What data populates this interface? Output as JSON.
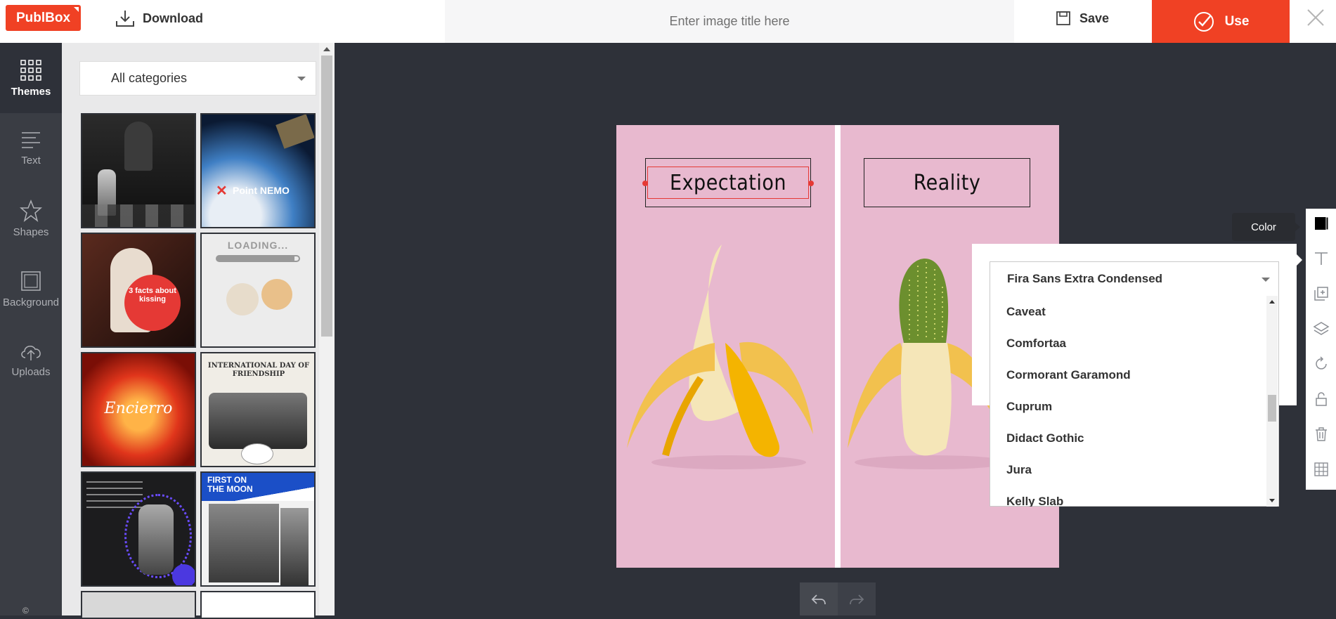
{
  "app": {
    "logo": "PublBox"
  },
  "header": {
    "download_label": "Download",
    "title_placeholder": "Enter image title here",
    "title_value": "",
    "save_label": "Save",
    "use_label": "Use"
  },
  "nav": {
    "items": [
      {
        "label": "Themes",
        "icon": "grid-icon",
        "active": true
      },
      {
        "label": "Text",
        "icon": "text-lines-icon",
        "active": false
      },
      {
        "label": "Shapes",
        "icon": "star-icon",
        "active": false
      },
      {
        "label": "Background",
        "icon": "frame-icon",
        "active": false
      },
      {
        "label": "Uploads",
        "icon": "cloud-upload-icon",
        "active": false
      }
    ],
    "copyright": "©"
  },
  "themes": {
    "category_selected": "All categories",
    "thumbnails": [
      {
        "name": "chess-theme",
        "caption": ""
      },
      {
        "name": "point-nemo-theme",
        "caption": "Point NEMO"
      },
      {
        "name": "kissing-theme",
        "caption": "3 facts about kissing"
      },
      {
        "name": "loading-theme",
        "caption": "LOADING..."
      },
      {
        "name": "encierro-theme",
        "caption": "Encierro"
      },
      {
        "name": "friendship-theme",
        "caption": "INTERNATIONAL DAY OF FRIENDSHIP"
      },
      {
        "name": "elevator-theme",
        "caption": ""
      },
      {
        "name": "first-moon-theme",
        "caption": "FIRST ON THE MOON"
      }
    ]
  },
  "canvas": {
    "left_text": "Expectation",
    "right_text": "Reality",
    "background_color": "#e8b9cf"
  },
  "toolbar": {
    "tooltip": "Color",
    "items": [
      "color-swatch-icon",
      "text-icon",
      "duplicate-icon",
      "layers-icon",
      "rotate-icon",
      "lock-icon",
      "trash-icon",
      "grid-table-icon"
    ]
  },
  "font_picker": {
    "selected": "Fira Sans Extra Condensed",
    "options": [
      "Caveat",
      "Comfortaa",
      "Cormorant Garamond",
      "Cuprum",
      "Didact Gothic",
      "Jura",
      "Kelly Slab"
    ]
  },
  "colors": {
    "accent": "#f04124",
    "editor_bg": "#2e3139",
    "sidebar_bg": "#3a3d44"
  }
}
